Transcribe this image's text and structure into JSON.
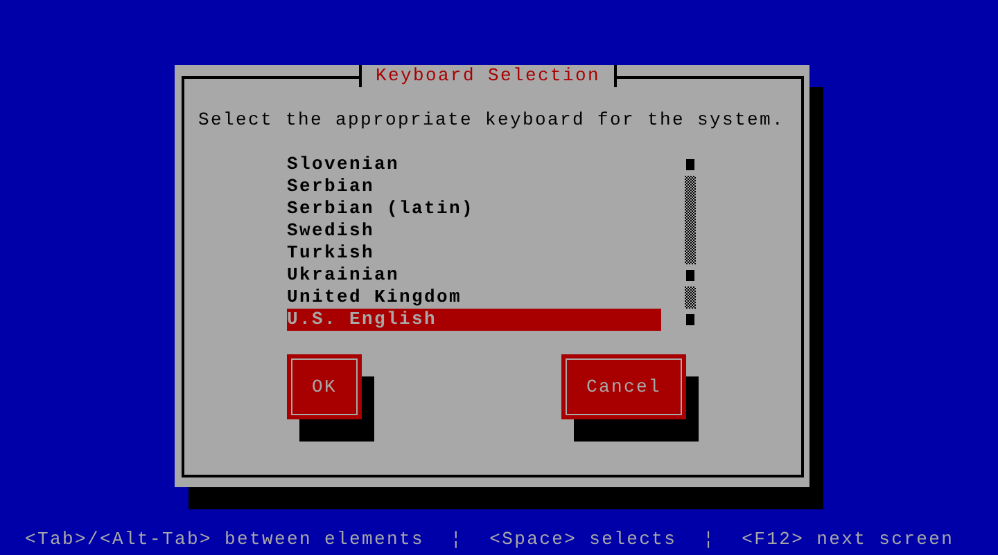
{
  "dialog": {
    "title": "Keyboard Selection",
    "prompt": "Select the appropriate keyboard for the system.",
    "list": [
      {
        "label": "Slovenian",
        "selected": false
      },
      {
        "label": "Serbian",
        "selected": false
      },
      {
        "label": "Serbian (latin)",
        "selected": false
      },
      {
        "label": "Swedish",
        "selected": false
      },
      {
        "label": "Turkish",
        "selected": false
      },
      {
        "label": "Ukrainian",
        "selected": false
      },
      {
        "label": "United Kingdom",
        "selected": false
      },
      {
        "label": "U.S. English",
        "selected": true
      }
    ],
    "buttons": [
      "OK",
      "Cancel"
    ]
  },
  "status_bar": [
    {
      "kind": "hint",
      "text": "<Tab>/<Alt-Tab> between elements"
    },
    {
      "kind": "separator",
      "text": "¦"
    },
    {
      "kind": "hint",
      "text": "<Space> selects"
    },
    {
      "kind": "separator",
      "text": "¦"
    },
    {
      "kind": "hint",
      "text": "<F12> next screen"
    }
  ]
}
